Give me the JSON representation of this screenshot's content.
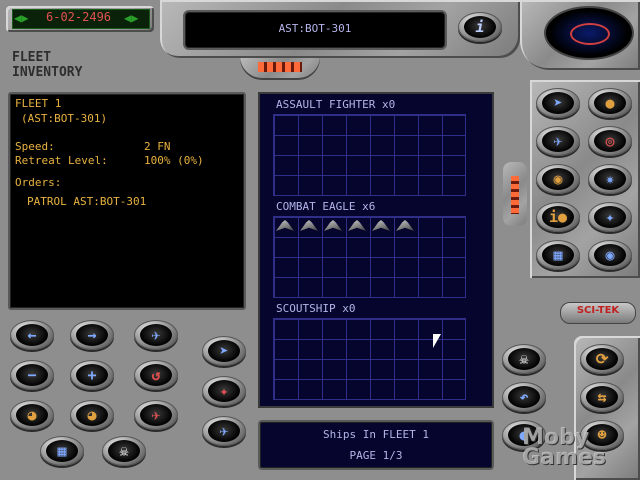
{
  "header": {
    "date": "6-02-2496",
    "location": "AST:BOT-301"
  },
  "panel_title_line1": "FLEET",
  "panel_title_line2": "INVENTORY",
  "info": {
    "fleet_name": "FLEET 1",
    "fleet_location": "(AST:BOT-301)",
    "speed_label": "Speed:",
    "speed_value": "2 FN",
    "retreat_label": "Retreat Level:",
    "retreat_value": "100% (0%)",
    "orders_label": "Orders:",
    "orders_value": "PATROL AST:BOT-301"
  },
  "sections": [
    {
      "title": "ASSAULT FIGHTER x0",
      "ship_count": 0
    },
    {
      "title": "COMBAT EAGLE x6",
      "ship_count": 6
    },
    {
      "title": "SCOUTSHIP x0",
      "ship_count": 0
    }
  ],
  "footer": {
    "caption": "Ships In FLEET 1",
    "page": "PAGE 1/3"
  },
  "brand": "SCI-TEK",
  "watermark": "Moby Games",
  "colors": {
    "info_text": "#e8b240",
    "grid_line": "#2f2f8a",
    "grid_text": "#b4b4e8",
    "button_glyph": "#7fa8ff",
    "date_text": "#e05050"
  }
}
